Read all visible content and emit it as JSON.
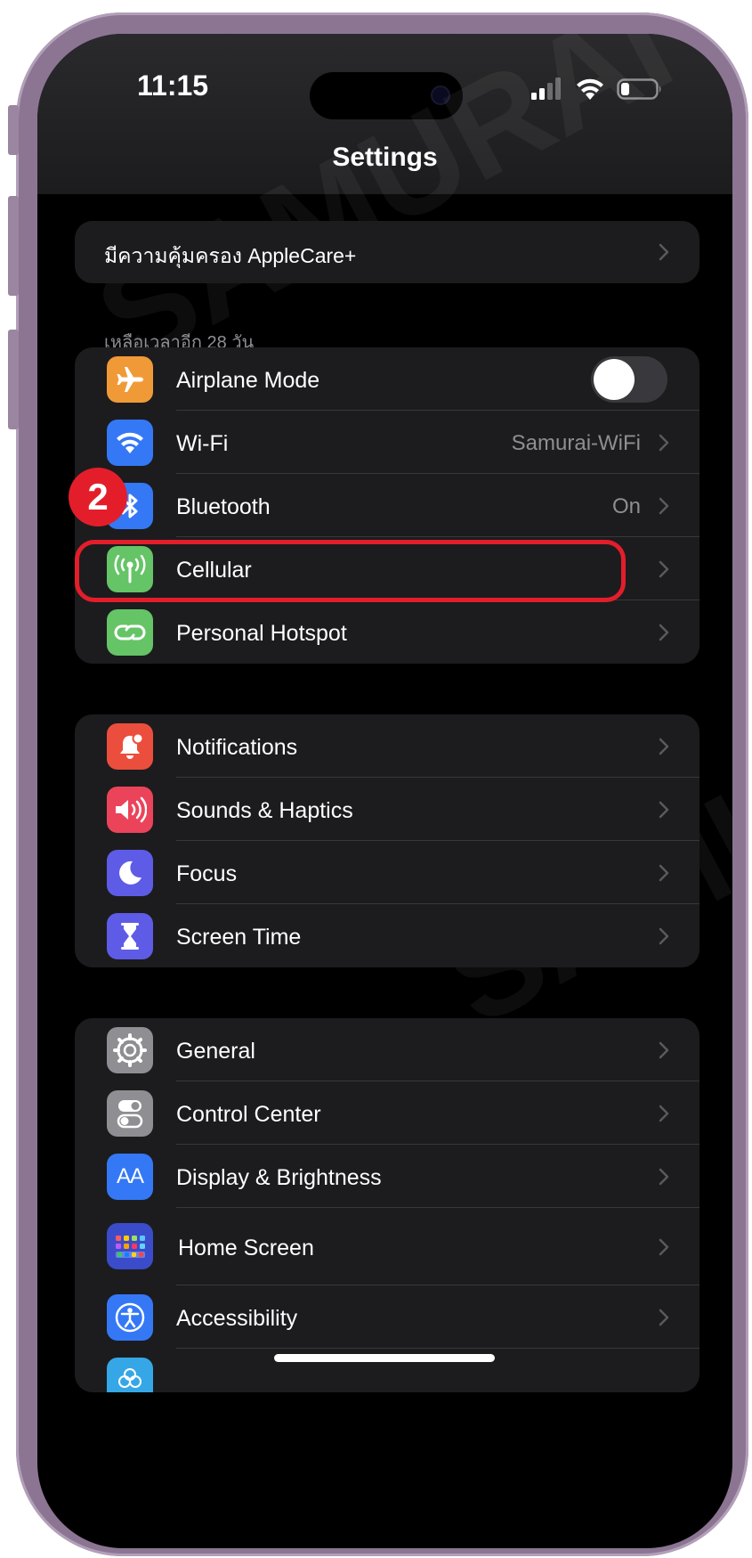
{
  "status_bar": {
    "time": "11:15"
  },
  "nav": {
    "title": "Settings"
  },
  "applecare": {
    "label": "มีความคุ้มครอง AppleCare+",
    "footer": "เหลือเวลาอีก 28 วัน"
  },
  "connectivity": [
    {
      "label": "Airplane Mode",
      "value": "",
      "icon": "airplane-icon",
      "color": "#f09a37",
      "toggle": false
    },
    {
      "label": "Wi-Fi",
      "value": "Samurai-WiFi",
      "icon": "wifi-icon",
      "color": "#3478f6"
    },
    {
      "label": "Bluetooth",
      "value": "On",
      "icon": "bluetooth-icon",
      "color": "#3478f6"
    },
    {
      "label": "Cellular",
      "value": "",
      "icon": "antenna-icon",
      "color": "#65c466"
    },
    {
      "label": "Personal Hotspot",
      "value": "",
      "icon": "hotspot-link-icon",
      "color": "#65c466"
    }
  ],
  "alerts": [
    {
      "label": "Notifications",
      "icon": "bell-icon",
      "color": "#eb4e3d"
    },
    {
      "label": "Sounds & Haptics",
      "icon": "speaker-icon",
      "color": "#eb445a"
    },
    {
      "label": "Focus",
      "icon": "moon-icon",
      "color": "#5e5ce6"
    },
    {
      "label": "Screen Time",
      "icon": "hourglass-icon",
      "color": "#5e5ce6"
    }
  ],
  "general": [
    {
      "label": "General",
      "icon": "gear-icon",
      "color": "#8e8e93"
    },
    {
      "label": "Control Center",
      "icon": "switches-icon",
      "color": "#8e8e93"
    },
    {
      "label": "Display & Brightness",
      "icon": "text-size-icon",
      "color": "#3478f6",
      "glyph": "AA"
    },
    {
      "label": "Home Screen",
      "icon": "app-grid-icon",
      "color": "#3a4cc9"
    },
    {
      "label": "Accessibility",
      "icon": "accessibility-icon",
      "color": "#3478f6"
    }
  ],
  "annotation": {
    "step": "2",
    "highlight_color": "#e31e2a"
  },
  "watermark": "SAMURAI"
}
